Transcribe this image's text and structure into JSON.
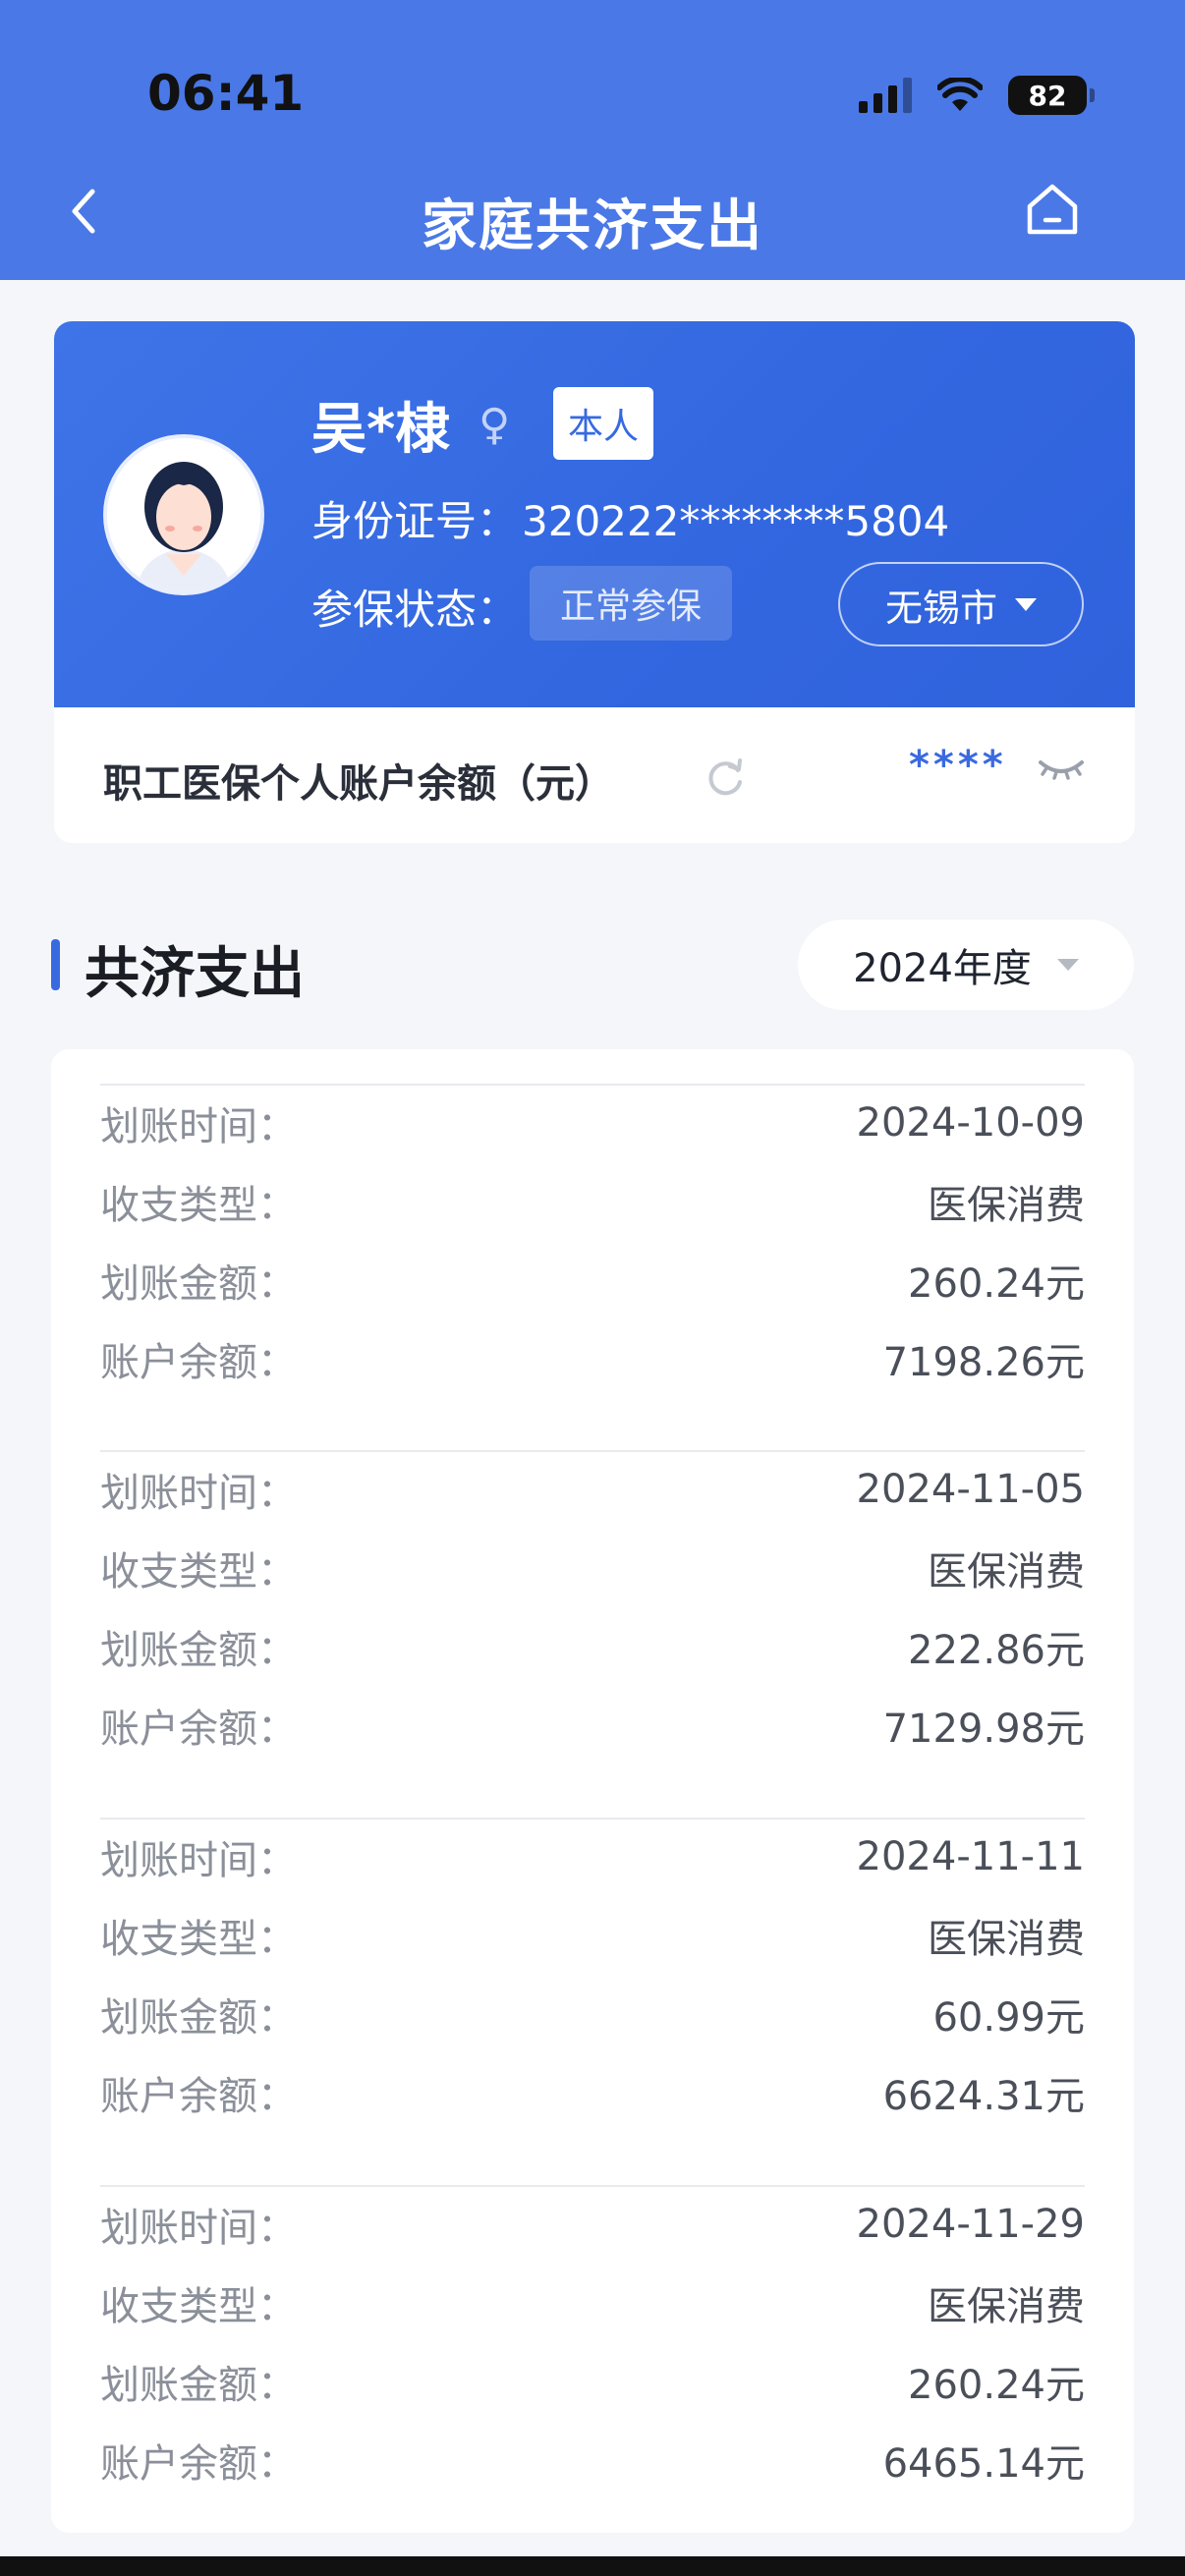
{
  "status_bar": {
    "time": "06:41",
    "battery": "82"
  },
  "header": {
    "title": "家庭共济支出"
  },
  "profile": {
    "name": "吴*棣",
    "gender_symbol": "♀",
    "relation_tag": "本人",
    "id_label": "身份证号：",
    "id_value": "320222********5804",
    "status_label": "参保状态：",
    "status_value": "正常参保",
    "city": "无锡市"
  },
  "balance": {
    "label": "职工医保个人账户余额（元）",
    "value": "****"
  },
  "section": {
    "title": "共济支出",
    "year": "2024年度"
  },
  "records": [
    {
      "time_label": "划账时间：",
      "time": "2024-10-09",
      "type_label": "收支类型：",
      "type": "医保消费",
      "amount_label": "划账金额：",
      "amount": "260.24元",
      "balance_label": "账户余额：",
      "balance": "7198.26元"
    },
    {
      "time_label": "划账时间：",
      "time": "2024-11-05",
      "type_label": "收支类型：",
      "type": "医保消费",
      "amount_label": "划账金额：",
      "amount": "222.86元",
      "balance_label": "账户余额：",
      "balance": "7129.98元"
    },
    {
      "time_label": "划账时间：",
      "time": "2024-11-11",
      "type_label": "收支类型：",
      "type": "医保消费",
      "amount_label": "划账金额：",
      "amount": "60.99元",
      "balance_label": "账户余额：",
      "balance": "6624.31元"
    },
    {
      "time_label": "划账时间：",
      "time": "2024-11-29",
      "type_label": "收支类型：",
      "type": "医保消费",
      "amount_label": "划账金额：",
      "amount": "260.24元",
      "balance_label": "账户余额：",
      "balance": "6465.14元"
    }
  ]
}
